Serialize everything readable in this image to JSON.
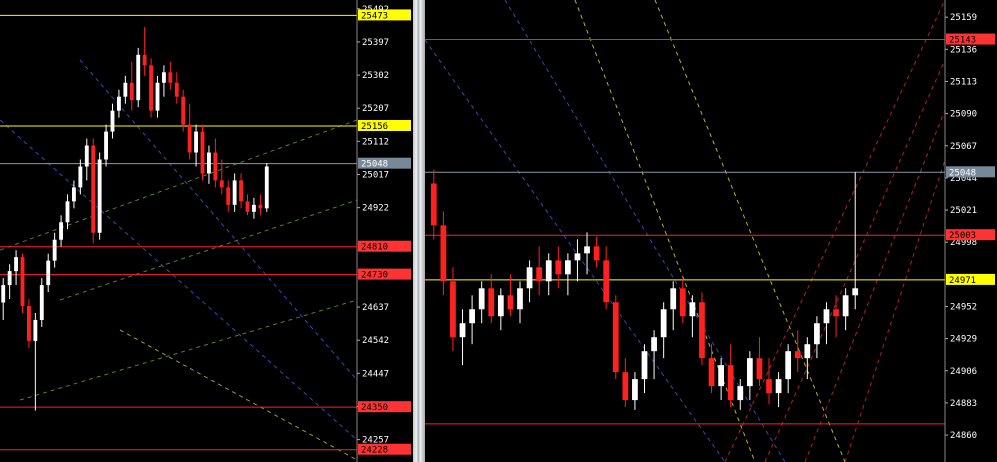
{
  "chart_data": [
    {
      "type": "candlestick",
      "panel": "left",
      "ylim": [
        24210,
        25500
      ],
      "grid": false,
      "axis_ticks": [
        {
          "value": 25492,
          "label": "25492"
        },
        {
          "value": 25397,
          "label": "25397"
        },
        {
          "value": 25302,
          "label": "25302"
        },
        {
          "value": 25207,
          "label": "25207"
        },
        {
          "value": 25112,
          "label": "25112"
        },
        {
          "value": 25017,
          "label": "25017"
        },
        {
          "value": 24922,
          "label": "24922"
        },
        {
          "value": 24637,
          "label": "24637"
        },
        {
          "value": 24542,
          "label": "24542"
        },
        {
          "value": 24447,
          "label": "24447"
        },
        {
          "value": 24352,
          "label": "24352"
        },
        {
          "value": 24257,
          "label": "24257"
        }
      ],
      "price_tags": [
        {
          "value": 25473,
          "label": "25473",
          "color": "#ffff00",
          "text_color": "#000000"
        },
        {
          "value": 25156,
          "label": "25156",
          "color": "#ffff00",
          "text_color": "#000000"
        },
        {
          "value": 25048,
          "label": "25048",
          "color": "#778899",
          "text_color": "#ffffff"
        },
        {
          "value": 24810,
          "label": "24810",
          "color": "#ff3333",
          "text_color": "#000000"
        },
        {
          "value": 24730,
          "label": "24730",
          "color": "#ff3333",
          "text_color": "#000000"
        },
        {
          "value": 24350,
          "label": "24350",
          "color": "#ff3333",
          "text_color": "#000000"
        },
        {
          "value": 24228,
          "label": "24228",
          "color": "#ff3333",
          "text_color": "#000000"
        }
      ],
      "candles": [
        [
          24650,
          24720,
          24600,
          24700
        ],
        [
          24700,
          24760,
          24660,
          24740
        ],
        [
          24740,
          24800,
          24700,
          24780
        ],
        [
          24780,
          24790,
          24620,
          24640
        ],
        [
          24640,
          24660,
          24520,
          24540
        ],
        [
          24540,
          24620,
          24340,
          24600
        ],
        [
          24600,
          24720,
          24580,
          24700
        ],
        [
          24700,
          24790,
          24680,
          24770
        ],
        [
          24770,
          24850,
          24750,
          24830
        ],
        [
          24830,
          24900,
          24810,
          24880
        ],
        [
          24880,
          24960,
          24860,
          24940
        ],
        [
          24940,
          25000,
          24920,
          24980
        ],
        [
          24980,
          25060,
          24960,
          25040
        ],
        [
          25040,
          25120,
          25000,
          25100
        ],
        [
          25100,
          25120,
          24820,
          24850
        ],
        [
          24850,
          25080,
          24830,
          25060
        ],
        [
          25060,
          25160,
          25040,
          25140
        ],
        [
          25140,
          25220,
          25120,
          25200
        ],
        [
          25200,
          25260,
          25180,
          25240
        ],
        [
          25240,
          25300,
          25220,
          25280
        ],
        [
          25280,
          25340,
          25200,
          25230
        ],
        [
          25230,
          25380,
          25210,
          25360
        ],
        [
          25360,
          25440,
          25300,
          25330
        ],
        [
          25330,
          25350,
          25180,
          25200
        ],
        [
          25200,
          25300,
          25180,
          25280
        ],
        [
          25280,
          25330,
          25240,
          25310
        ],
        [
          25310,
          25340,
          25260,
          25280
        ],
        [
          25280,
          25310,
          25220,
          25240
        ],
        [
          25240,
          25260,
          25140,
          25160
        ],
        [
          25160,
          25220,
          25060,
          25080
        ],
        [
          25080,
          25160,
          25040,
          25140
        ],
        [
          25140,
          25160,
          25000,
          25020
        ],
        [
          25020,
          25100,
          24990,
          25080
        ],
        [
          25080,
          25120,
          24980,
          25000
        ],
        [
          25000,
          25060,
          24960,
          24980
        ],
        [
          24980,
          25000,
          24910,
          24930
        ],
        [
          24930,
          25020,
          24910,
          25000
        ],
        [
          25000,
          25020,
          24920,
          24940
        ],
        [
          24940,
          24960,
          24900,
          24910
        ],
        [
          24910,
          24950,
          24890,
          24930
        ],
        [
          24930,
          24960,
          24900,
          24920
        ],
        [
          24920,
          25050,
          24910,
          25040
        ]
      ],
      "horizontal_lines": [
        {
          "value": 25473,
          "color": "#ffff00"
        },
        {
          "value": 25156,
          "color": "#ffff00"
        },
        {
          "value": 25048,
          "color": "#8899aa"
        },
        {
          "value": 24810,
          "color": "#ff2020"
        },
        {
          "value": 24730,
          "color": "#ff2020"
        },
        {
          "value": 24350,
          "color": "#ff2020"
        },
        {
          "value": 24228,
          "color": "#ff2020"
        }
      ]
    },
    {
      "type": "candlestick",
      "panel": "right",
      "ylim": [
        24845,
        25167
      ],
      "grid": false,
      "axis_ticks": [
        {
          "value": 25159,
          "label": "25159"
        },
        {
          "value": 25136,
          "label": "25136"
        },
        {
          "value": 25113,
          "label": "25113"
        },
        {
          "value": 25090,
          "label": "25090"
        },
        {
          "value": 25067,
          "label": "25067"
        },
        {
          "value": 25044,
          "label": "25044"
        },
        {
          "value": 25021,
          "label": "25021"
        },
        {
          "value": 24998,
          "label": "24998"
        },
        {
          "value": 24952,
          "label": "24952"
        },
        {
          "value": 24929,
          "label": "24929"
        },
        {
          "value": 24906,
          "label": "24906"
        },
        {
          "value": 24883,
          "label": "24883"
        },
        {
          "value": 24860,
          "label": "24860"
        }
      ],
      "price_tags": [
        {
          "value": 25143,
          "label": "25143",
          "color": "#ff3333",
          "text_color": "#000000"
        },
        {
          "value": 25048,
          "label": "25048",
          "color": "#778899",
          "text_color": "#ffffff"
        },
        {
          "value": 25003,
          "label": "25003",
          "color": "#ff3333",
          "text_color": "#000000"
        },
        {
          "value": 24971,
          "label": "24971",
          "color": "#ffff00",
          "text_color": "#000000"
        }
      ],
      "candles": [
        [
          25040,
          25050,
          25000,
          25010
        ],
        [
          25010,
          25020,
          24960,
          24970
        ],
        [
          24970,
          24980,
          24920,
          24930
        ],
        [
          24930,
          24950,
          24910,
          24940
        ],
        [
          24940,
          24960,
          24925,
          24950
        ],
        [
          24950,
          24970,
          24940,
          24965
        ],
        [
          24965,
          24975,
          24940,
          24945
        ],
        [
          24945,
          24965,
          24935,
          24960
        ],
        [
          24960,
          24975,
          24945,
          24950
        ],
        [
          24950,
          24970,
          24940,
          24965
        ],
        [
          24965,
          24985,
          24955,
          24980
        ],
        [
          24980,
          24995,
          24960,
          24970
        ],
        [
          24970,
          24990,
          24960,
          24985
        ],
        [
          24985,
          24995,
          24965,
          24975
        ],
        [
          24975,
          24990,
          24960,
          24985
        ],
        [
          24985,
          25000,
          24970,
          24990
        ],
        [
          24990,
          25005,
          24975,
          24995
        ],
        [
          24995,
          25002,
          24980,
          24985
        ],
        [
          24985,
          24995,
          24950,
          24955
        ],
        [
          24955,
          24960,
          24900,
          24905
        ],
        [
          24905,
          24915,
          24880,
          24885
        ],
        [
          24885,
          24905,
          24878,
          24900
        ],
        [
          24900,
          24925,
          24890,
          24920
        ],
        [
          24920,
          24935,
          24900,
          24930
        ],
        [
          24930,
          24955,
          24915,
          24950
        ],
        [
          24950,
          24970,
          24935,
          24965
        ],
        [
          24965,
          24972,
          24940,
          24945
        ],
        [
          24945,
          24960,
          24930,
          24955
        ],
        [
          24955,
          24962,
          24910,
          24915
        ],
        [
          24915,
          24925,
          24890,
          24895
        ],
        [
          24895,
          24915,
          24885,
          24910
        ],
        [
          24910,
          24925,
          24880,
          24885
        ],
        [
          24885,
          24900,
          24878,
          24895
        ],
        [
          24895,
          24920,
          24885,
          24915
        ],
        [
          24915,
          24930,
          24895,
          24900
        ],
        [
          24900,
          24915,
          24882,
          24890
        ],
        [
          24890,
          24905,
          24880,
          24900
        ],
        [
          24900,
          24925,
          24890,
          24920
        ],
        [
          24920,
          24935,
          24905,
          24915
        ],
        [
          24915,
          24930,
          24900,
          24925
        ],
        [
          24925,
          24945,
          24915,
          24940
        ],
        [
          24940,
          24955,
          24925,
          24950
        ],
        [
          24950,
          24960,
          24930,
          24945
        ],
        [
          24945,
          24965,
          24935,
          24960
        ],
        [
          24960,
          25048,
          24950,
          24965
        ]
      ],
      "horizontal_lines": [
        {
          "value": 25143,
          "color": "#ff2020"
        },
        {
          "value": 25048,
          "color": "#8899aa"
        },
        {
          "value": 25003,
          "color": "#ff2020"
        },
        {
          "value": 24971,
          "color": "#ffff00"
        },
        {
          "value": 24868,
          "color": "#ff2020"
        }
      ]
    }
  ]
}
